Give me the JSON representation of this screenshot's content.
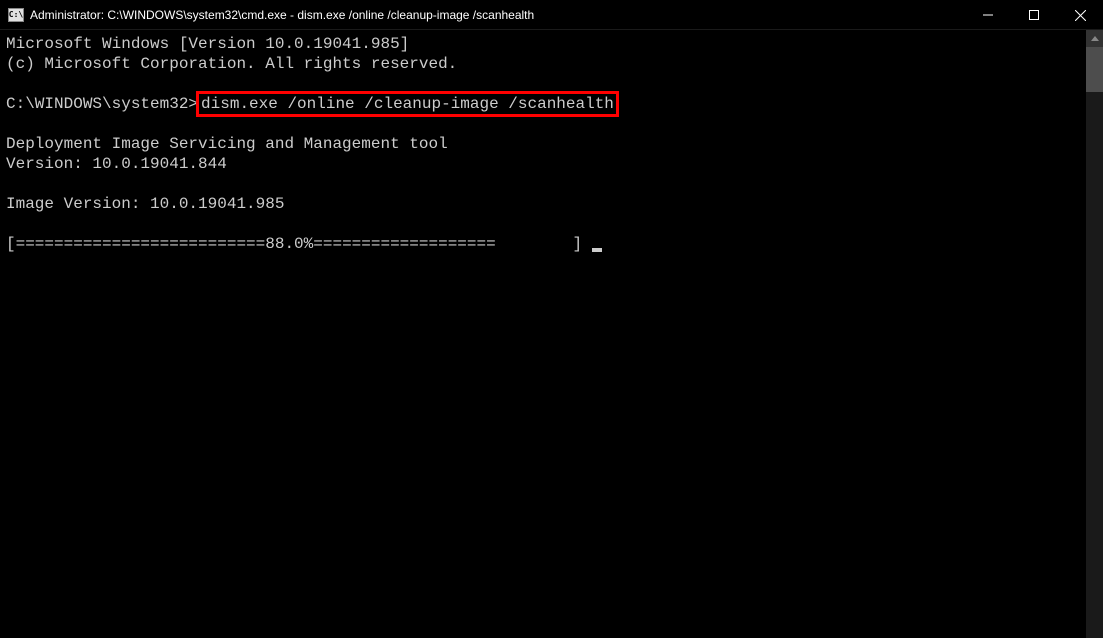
{
  "titlebar": {
    "title": "Administrator: C:\\WINDOWS\\system32\\cmd.exe - dism.exe  /online /cleanup-image /scanhealth"
  },
  "terminal": {
    "line1": "Microsoft Windows [Version 10.0.19041.985]",
    "line2": "(c) Microsoft Corporation. All rights reserved.",
    "prompt": "C:\\WINDOWS\\system32>",
    "command": "dism.exe /online /cleanup-image /scanhealth",
    "tool_name": "Deployment Image Servicing and Management tool",
    "tool_version": "Version: 10.0.19041.844",
    "image_version": "Image Version: 10.0.19041.985",
    "progress_left": "[==========================",
    "progress_pct": "88.0%",
    "progress_right": "===================",
    "progress_spaces": "        ",
    "progress_bracket": "] "
  }
}
